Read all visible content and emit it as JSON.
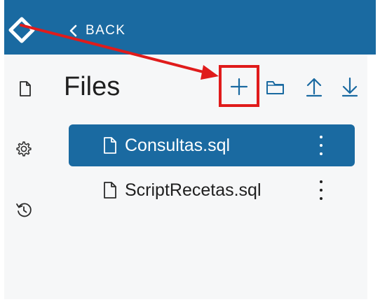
{
  "header": {
    "back_label": "BACK"
  },
  "rail": {
    "items": [
      {
        "icon": "document-icon"
      },
      {
        "icon": "gear-icon"
      },
      {
        "icon": "history-icon"
      }
    ]
  },
  "files_panel": {
    "title": "Files",
    "toolbar": [
      "add-icon",
      "folder-icon",
      "upload-icon",
      "download-icon"
    ],
    "files": [
      {
        "name": "Consultas.sql",
        "selected": true
      },
      {
        "name": "ScriptRecetas.sql",
        "selected": false
      }
    ]
  },
  "colors": {
    "brand": "#1a6aa1",
    "annotation_red": "#e01b1b",
    "panel_bg": "#f6f7f8"
  }
}
